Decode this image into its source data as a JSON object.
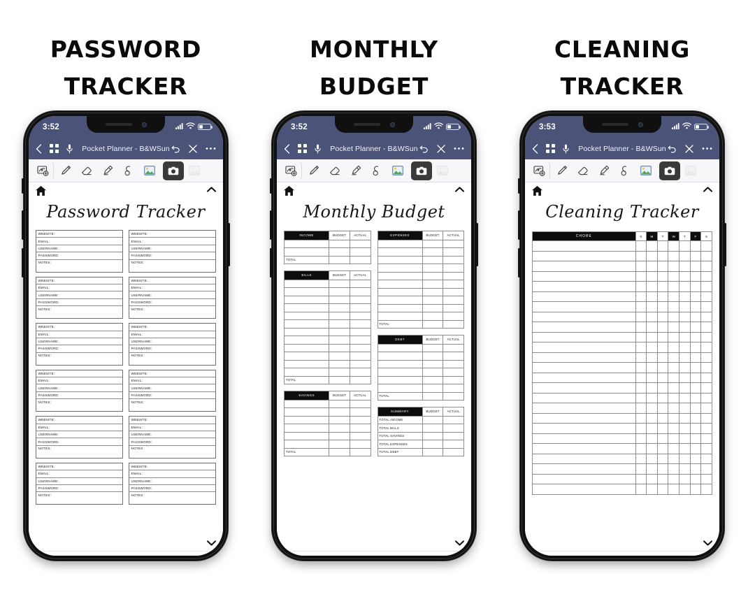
{
  "meta": {
    "accent_navy": "#4c5378",
    "ink": "#0d0d0d"
  },
  "app": {
    "title": "Pocket Planner - B&WSun",
    "nav": {
      "back_label": "Back",
      "pages_label": "Pages",
      "record_label": "Record",
      "undo_label": "Undo",
      "close_label": "Close",
      "more_label": "More"
    },
    "toolbar": {
      "tools": [
        {
          "name": "lasso-select-icon",
          "label": "Lasso Select",
          "state": "normal"
        },
        {
          "name": "pen-icon",
          "label": "Pen",
          "state": "normal"
        },
        {
          "name": "eraser-icon",
          "label": "Eraser",
          "state": "normal"
        },
        {
          "name": "highlighter-icon",
          "label": "Highlighter",
          "state": "normal"
        },
        {
          "name": "shape-icon",
          "label": "Shape",
          "state": "normal"
        },
        {
          "name": "image-icon",
          "label": "Insert Image",
          "state": "normal"
        },
        {
          "name": "camera-icon",
          "label": "Camera",
          "state": "active"
        },
        {
          "name": "sticker-icon",
          "label": "Sticker",
          "state": "disabled"
        }
      ]
    }
  },
  "phones": [
    {
      "poster_line1": "PASSWORD",
      "poster_line2": "TRACKER",
      "status": {
        "time": "3:52",
        "signal": "cellular-signal-icon",
        "wifi": "wifi-icon",
        "battery": "battery-low-icon"
      },
      "page_title": "Password Tracker",
      "password_tracker": {
        "field_labels": [
          "WEBSITE:",
          "EMAIL:",
          "USERNAME:",
          "PASSWORD:",
          "NOTES:"
        ],
        "rows": 6,
        "columns": 2,
        "blocks": 12
      }
    },
    {
      "poster_line1": "MONTHLY",
      "poster_line2": "BUDGET",
      "status": {
        "time": "3:52",
        "signal": "cellular-signal-icon",
        "wifi": "wifi-icon",
        "battery": "battery-low-icon"
      },
      "page_title": "Monthly Budget",
      "budget": {
        "value_headers": [
          "BUDGET",
          "ACTUAL"
        ],
        "total_label": "TOTAL",
        "left_tables": [
          {
            "name": "INCOME",
            "blank_rows": 2,
            "has_total": true
          },
          {
            "name": "BILLS",
            "blank_rows": 12,
            "has_total": true
          },
          {
            "name": "SAVINGS",
            "blank_rows": 6,
            "has_total": true
          }
        ],
        "right_tables": [
          {
            "name": "EXPENSES",
            "blank_rows": 10,
            "has_total": true
          },
          {
            "name": "DEBT",
            "blank_rows": 6,
            "has_total": true
          }
        ],
        "summary": {
          "name": "SUMMARY",
          "rows": [
            "TOTAL INCOME",
            "TOTAL BILLS",
            "TOTAL SAVINGS",
            "TOTAL EXPENSES",
            "TOTAL DEBT"
          ]
        }
      }
    },
    {
      "poster_line1": "CLEANING",
      "poster_line2": "TRACKER",
      "status": {
        "time": "3:53",
        "signal": "cellular-signal-icon",
        "wifi": "wifi-icon",
        "battery": "battery-low-icon"
      },
      "page_title": "Cleaning Tracker",
      "cleaning_tracker": {
        "chore_header": "CHORE",
        "days": [
          {
            "letter": "S",
            "shade": "light"
          },
          {
            "letter": "M",
            "shade": "dark"
          },
          {
            "letter": "T",
            "shade": "light"
          },
          {
            "letter": "W",
            "shade": "dark"
          },
          {
            "letter": "T",
            "shade": "light"
          },
          {
            "letter": "F",
            "shade": "dark"
          },
          {
            "letter": "S",
            "shade": "light"
          }
        ],
        "blank_rows": 25
      }
    }
  ]
}
